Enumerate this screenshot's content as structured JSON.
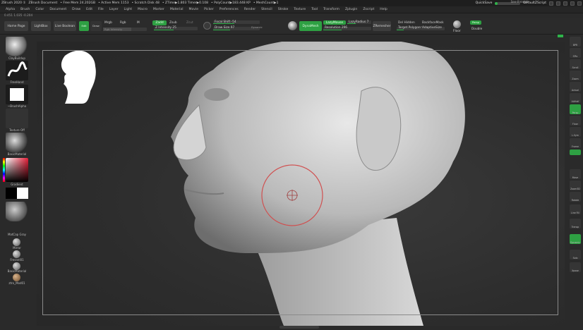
{
  "titlebar": {
    "app": "ZBrush 2020 ①",
    "document": "ZBrush Document",
    "free_mem": "• Free Mem 24.202GB",
    "active_mem": "• Active Mem 1153",
    "scratch_disk": "• Scratch Disk 48",
    "ztime": "• ZTime▶1.803 Timer▶0.108",
    "polycount": "• PolyCount▶183.448 KP",
    "meshcount": "• MeshCount▶1",
    "quicksave": "QuickSave",
    "see_through_label": "See-through",
    "see_through_value": 0,
    "default_script": "DefaultZScript"
  },
  "menu": [
    "Alpha",
    "Brush",
    "Color",
    "Document",
    "Draw",
    "Edit",
    "File",
    "Layer",
    "Light",
    "Macro",
    "Marker",
    "Material",
    "Movie",
    "Picker",
    "Preferences",
    "Render",
    "Stencil",
    "Stroke",
    "Texture",
    "Tool",
    "Transform",
    "Zplugin",
    "Zscript",
    "Help"
  ],
  "status_row": "0.451 1.035 -0.204",
  "toolbar": {
    "home_page": "Home Page",
    "lightbox": "LightBox",
    "live_boolean": "Live Boolean",
    "edit": "Edit",
    "draw": "Draw",
    "mrgb": "Mrgb",
    "rgb": "Rgb",
    "m": "M",
    "zadd": "Zadd",
    "zsub": "Zsub",
    "zcut": "Zcut",
    "rgb_intensity": "Rgb Intensity",
    "z_intensity": "Z Intensity 25",
    "focal_shift": "Focal Shift -54",
    "draw_size": "Draw Size 97",
    "dynamic": "Dynamic",
    "dynamesh": "DynaMesh",
    "lazymouse": "LazyMouse",
    "lazyradius": "LazyRadius 7",
    "resolution": "Resolution 296",
    "zremesher": "ZRemesher",
    "del_hidden": "Del Hidden",
    "target_polygons": "Target Polygons",
    "backface_mask": "BackfaceMask",
    "adapt": "AdaptiveSize",
    "floor": "Floor",
    "persp": "Persp",
    "double": "Double"
  },
  "left_shelf": {
    "brush": "ClayBuildup",
    "stroke": "FreeHand",
    "alpha": "~BrushAlpha",
    "texture": "Texture Off",
    "material": "BasicMaterial",
    "gradient": "Gradient",
    "switch_color": "SwitchColor",
    "alternate": "Alternate",
    "mat1": "MatCap Gray",
    "mat2": "Mirror",
    "mat3": "Fresnel01",
    "mat4": "BasicMaterial",
    "mat5": "ztro_Mod01"
  },
  "right_shelf": [
    "BPR",
    "SPix",
    "Scroll",
    "Zoom",
    "Actual",
    "AAHalf",
    "Persp",
    "Floor",
    "L.Sym",
    "Frame",
    "Move",
    "Zoom3D",
    "Rotate",
    "Line Fill",
    "Transp",
    "Dynamic",
    "Solo",
    "Xpose"
  ],
  "colors": {
    "accent_green": "#2fb34a",
    "brush_cursor": "#d05050"
  }
}
